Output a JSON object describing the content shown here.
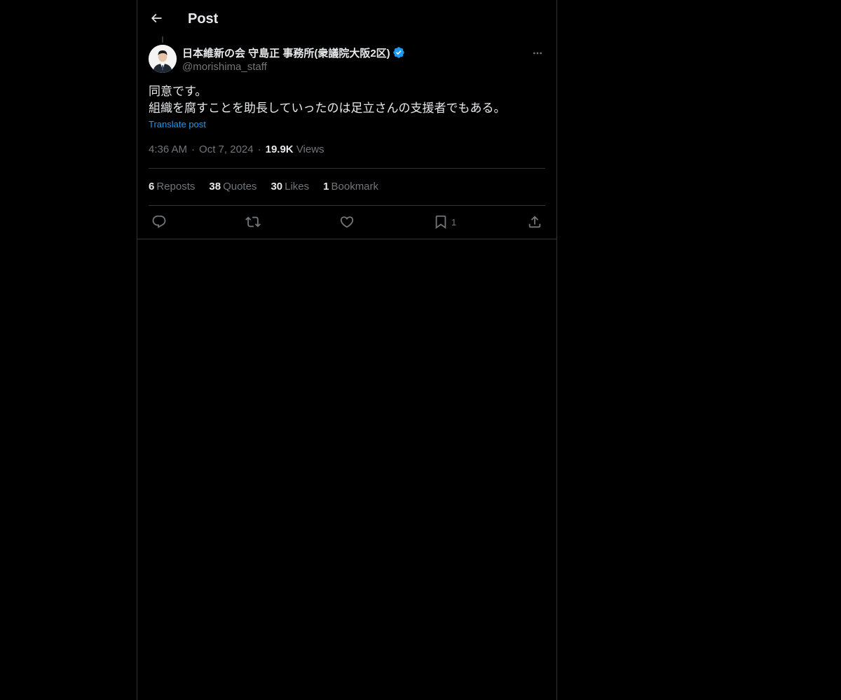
{
  "header": {
    "title": "Post",
    "back_icon": "arrow-left-icon"
  },
  "post": {
    "author": {
      "display_name": "日本維新の会 守島正 事務所(衆議院大阪2区)",
      "handle": "@morishima_staff",
      "verified": true,
      "verified_color": "#1d9bf0"
    },
    "text_lines": [
      "同意です。",
      "組織を腐すことを助長していったのは足立さんの支援者でもある。"
    ],
    "translate_label": "Translate post",
    "time": "4:36 AM",
    "date": "Oct 7, 2024",
    "views_count": "19.9K",
    "views_label": "Views",
    "stats": {
      "reposts": {
        "count": "6",
        "label": "Reposts"
      },
      "quotes": {
        "count": "38",
        "label": "Quotes"
      },
      "likes": {
        "count": "30",
        "label": "Likes"
      },
      "bookmarks": {
        "count": "1",
        "label": "Bookmark"
      }
    },
    "actions": {
      "reply_icon": "reply-icon",
      "repost_icon": "repost-icon",
      "like_icon": "heart-icon",
      "bookmark_icon": "bookmark-icon",
      "bookmark_count": "1",
      "share_icon": "share-icon"
    }
  },
  "colors": {
    "background": "#000000",
    "text_primary": "#e7e9ea",
    "text_secondary": "#71767b",
    "accent": "#1d9bf0",
    "border": "#2f3336"
  }
}
